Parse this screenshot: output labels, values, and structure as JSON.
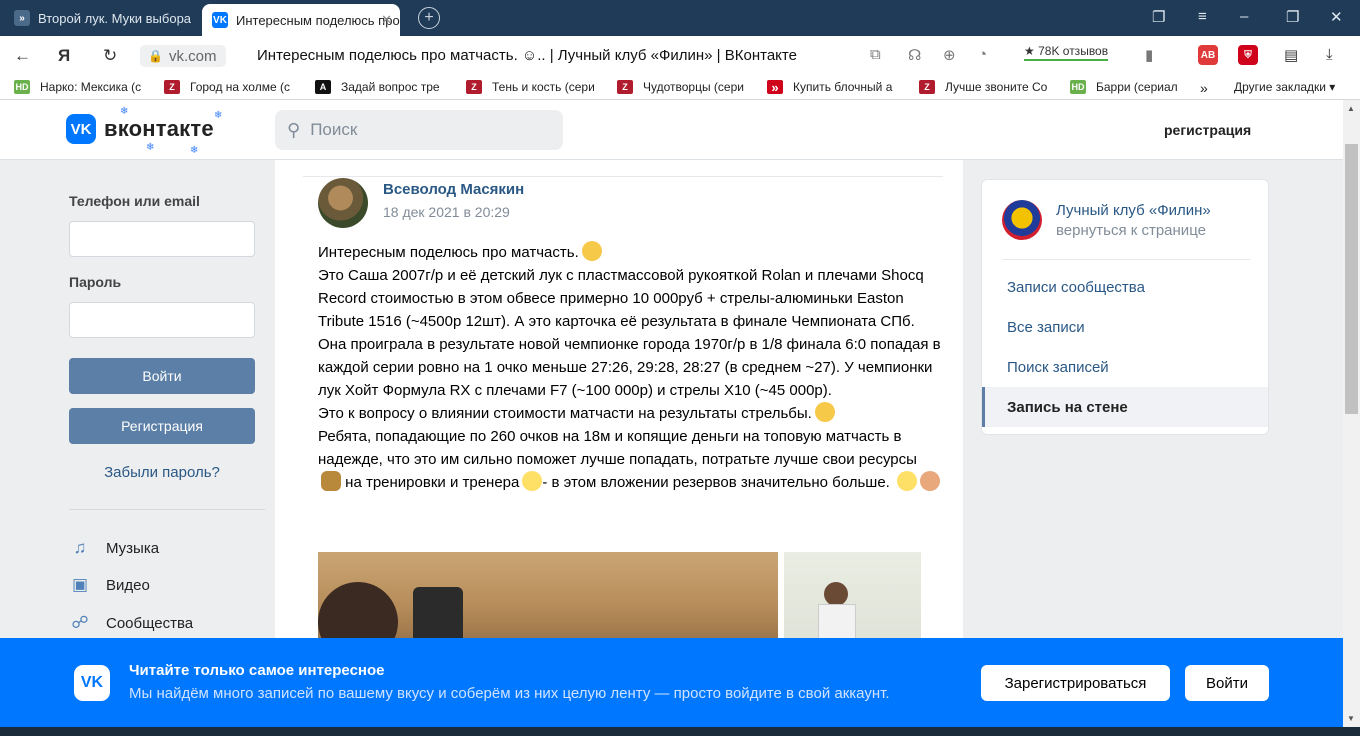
{
  "browser": {
    "tabs": [
      {
        "title": "Второй лук. Муки выбора",
        "close": "✕"
      },
      {
        "title": "Интересным поделюсь про",
        "close": "✕"
      }
    ],
    "new_tab": "+",
    "url": "vk.com",
    "page_title": "Интересным поделюсь про матчасть. ☺.. | Лучный клуб «Филин» | ВКонтакте",
    "reviews": "78K отзывов",
    "bookmarks": [
      {
        "label": "Нарко: Мексика (с",
        "icon": "HD",
        "color": "#6ab04c"
      },
      {
        "label": "Город на холме (с",
        "icon": "Z",
        "color": "#b01c2e"
      },
      {
        "label": "Задай вопрос тре",
        "icon": "A",
        "color": "#111111"
      },
      {
        "label": "Тень и кость (сери",
        "icon": "Z",
        "color": "#b01c2e"
      },
      {
        "label": "Чудотворцы (сери",
        "icon": "Z",
        "color": "#b01c2e"
      },
      {
        "label": "Купить блочный а",
        "icon": "»",
        "color": "#d0021b"
      },
      {
        "label": "Лучше звоните Со",
        "icon": "Z",
        "color": "#b01c2e"
      },
      {
        "label": "Барри (сериал",
        "icon": "HD",
        "color": "#6ab04c"
      }
    ],
    "bookmarks_more": "»",
    "other_bookmarks": "Другие закладки"
  },
  "header": {
    "logo_text": "вконтакте",
    "search_placeholder": "Поиск",
    "register_link": "регистрация"
  },
  "login": {
    "phone_label": "Телефон или email",
    "password_label": "Пароль",
    "login_button": "Войти",
    "register_button": "Регистрация",
    "forgot_link": "Забыли пароль?"
  },
  "menu": [
    {
      "label": "Музыка",
      "icon": "music-icon"
    },
    {
      "label": "Видео",
      "icon": "video-icon"
    },
    {
      "label": "Сообщества",
      "icon": "communities-icon"
    }
  ],
  "post": {
    "author": "Всеволод Масякин",
    "date": "18 дек 2021 в 20:29",
    "paragraphs": [
      "Интересным поделюсь про матчасть.",
      "Это Саша 2007г/р и её детский лук с пластмассовой рукояткой Rolan и плечами Shocq Record стоимостью в этом обвесе примерно 10 000руб + стрелы-алюминьки Easton Tribute 1516 (~4500р 12шт). А это карточка её результата в финале Чемпионата СПб. Она проиграла в результате новой чемпионке города 1970г/р в 1/8 финала 6:0 попадая в каждой серии ровно на 1 очко меньше 27:26, 29:28, 28:27 (в среднем ~27). У чемпионки лук Хойт Формула RX с плечами F7 (~100 000р) и стрелы Х10 (~45 000р).",
      "Это к вопросу о влиянии стоимости матчасти на результаты стрельбы.",
      "Ребята, попадающие по 260 очков на 18м и копящие деньги на топовую матчасть в надежде, что это им сильно поможет лучше попадать, потратьте лучше свои ресурсы",
      "на тренировки и тренера",
      "- в этом вложении резервов значительно больше."
    ]
  },
  "club": {
    "name": "Лучный клуб «Филин»",
    "back": "вернуться к странице",
    "items": [
      {
        "label": "Записи сообщества"
      },
      {
        "label": "Все записи"
      },
      {
        "label": "Поиск записей"
      },
      {
        "label": "Запись на стене"
      }
    ]
  },
  "banner": {
    "title": "Читайте только самое интересное",
    "subtitle": "Мы найдём много записей по вашему вкусу и соберём из них целую ленту — просто войдите в свой аккаунт.",
    "register_button": "Зарегистрироваться",
    "login_button": "Войти"
  },
  "colors": {
    "vk_blue": "#0077ff",
    "link": "#2a5885",
    "button": "#5b7fa6"
  }
}
